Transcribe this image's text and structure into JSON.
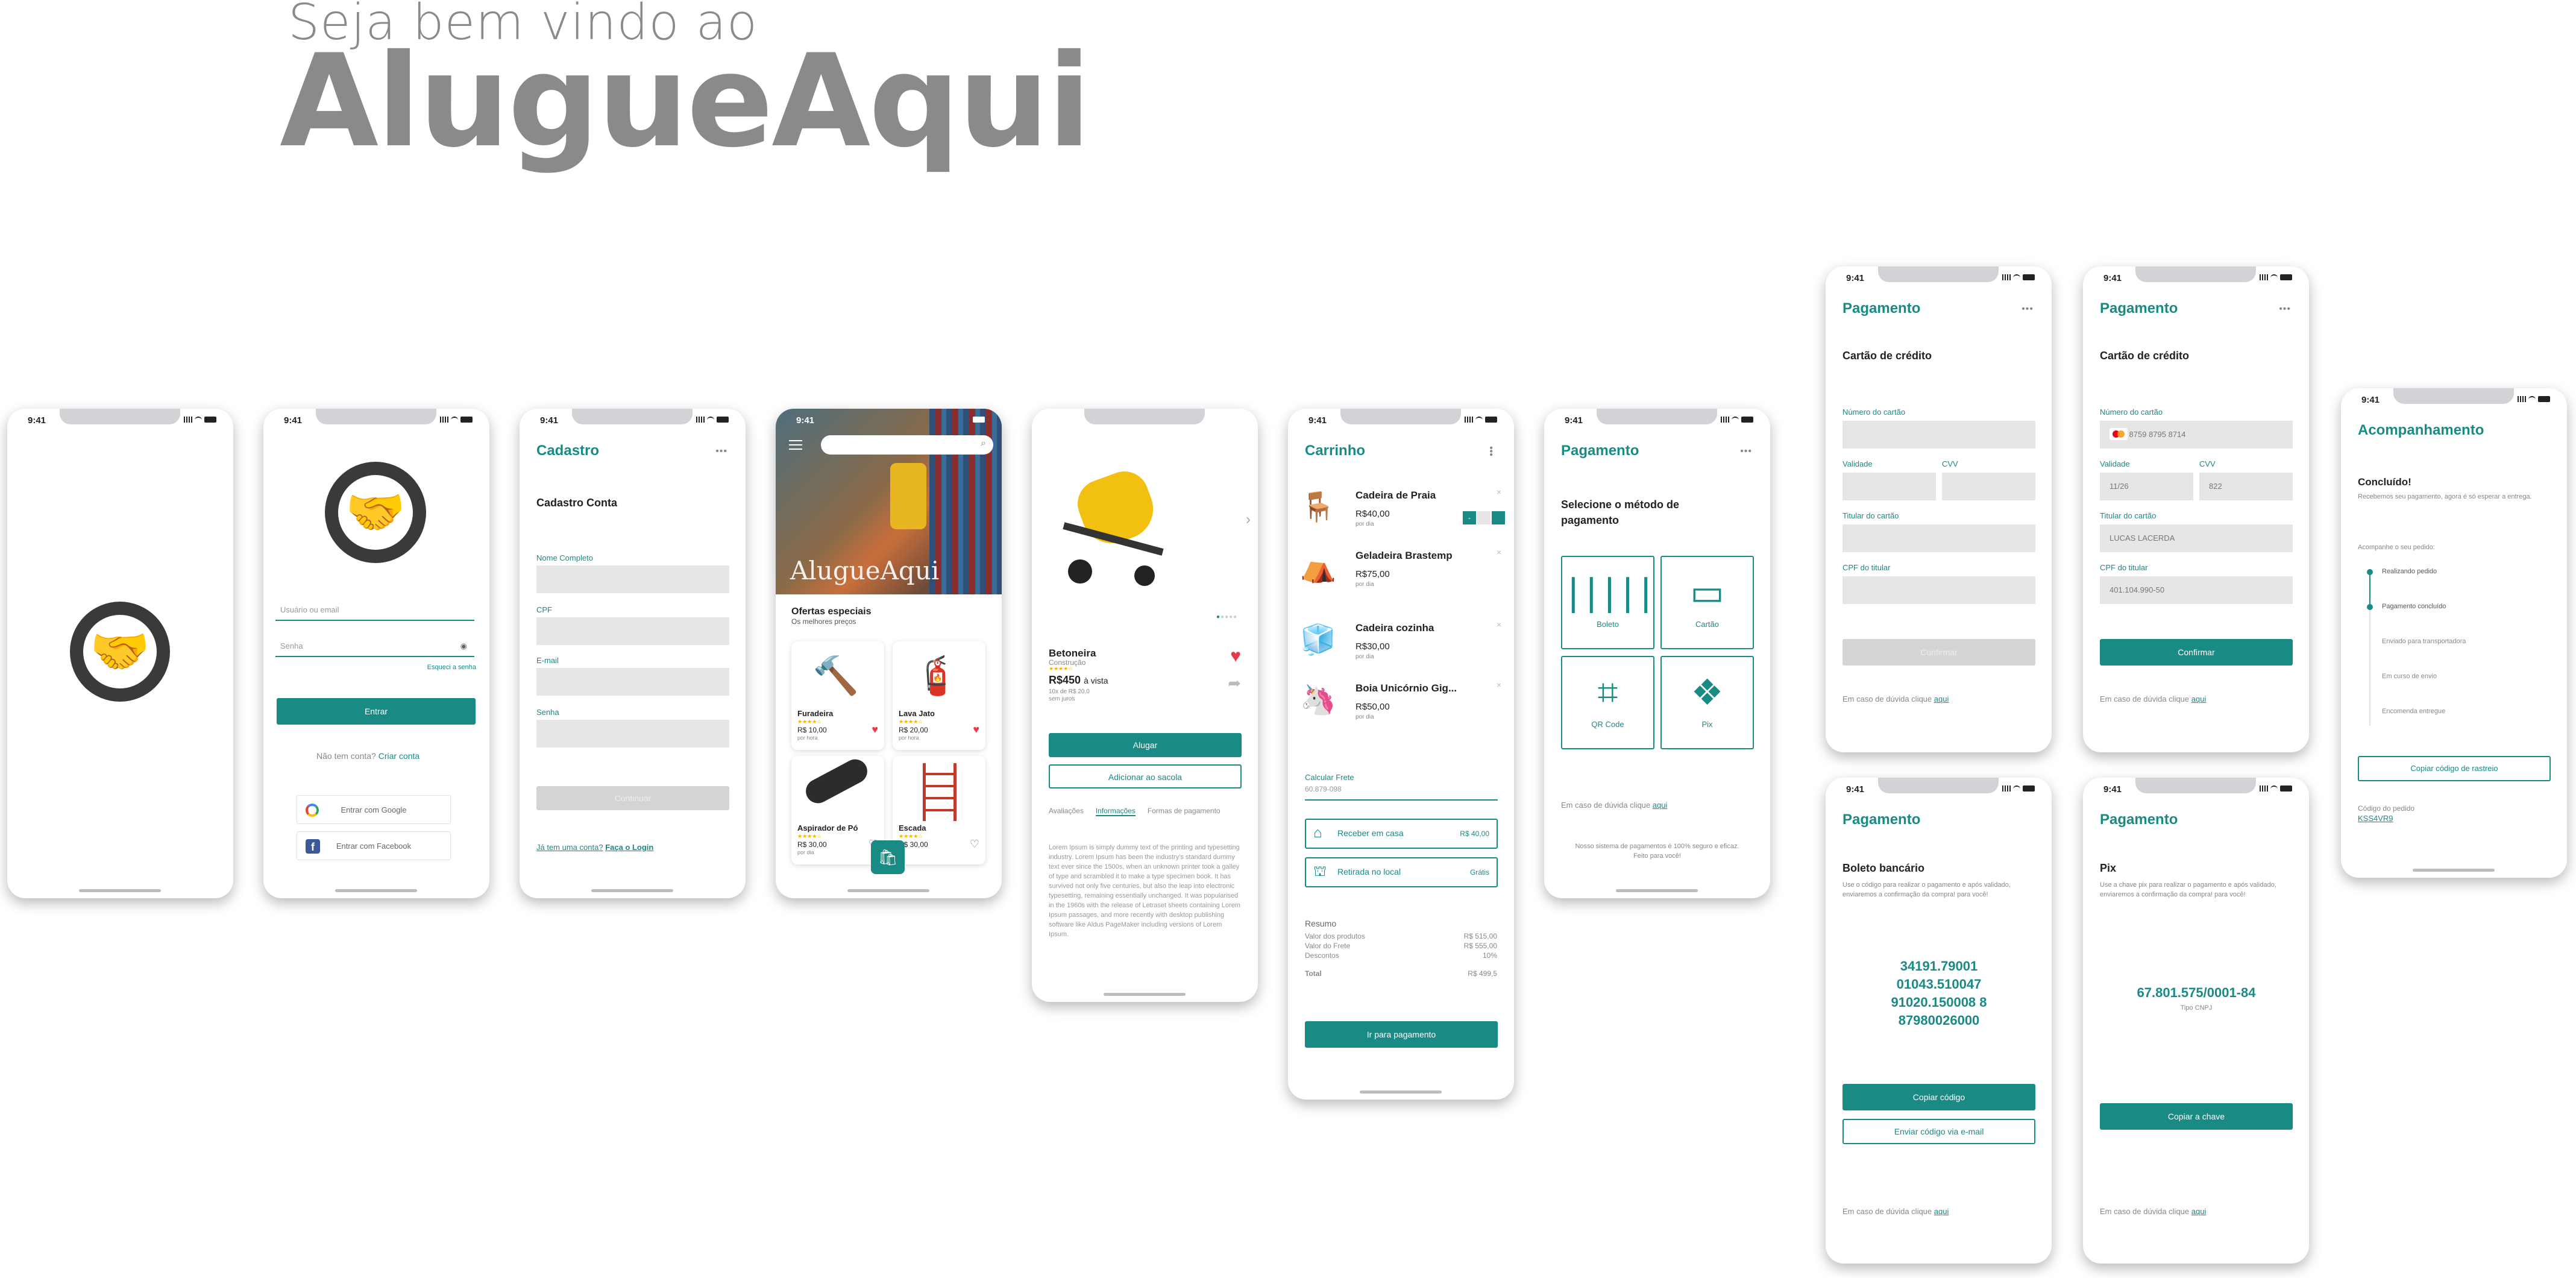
{
  "hero": {
    "subtitle": "Seja bem vindo ao",
    "title": "AlugueAqui"
  },
  "status_time": "9:41",
  "login": {
    "user_placeholder": "Usuário ou email",
    "password_placeholder": "Senha",
    "forgot": "Esqueci a senha",
    "enter": "Entrar",
    "no_account": "Não tem conta?",
    "create": "Criar conta",
    "google": "Entrar com Google",
    "facebook": "Entrar com Facebook"
  },
  "cadastro": {
    "title": "Cadastro",
    "section": "Cadastro Conta",
    "fields": [
      "Nome Completo",
      "CPF",
      "E-mail",
      "Senha"
    ],
    "continue": "Continuar",
    "has_account": "Já tem uma conta?",
    "login": "Faça o Login"
  },
  "home": {
    "brand": "AlugueAqui",
    "offers_title": "Ofertas especiais",
    "offers_sub": "Os melhores preços",
    "products": [
      {
        "name": "Furadeira",
        "price": "R$ 10,00",
        "per": "por hora",
        "fav": true
      },
      {
        "name": "Lava Jato",
        "price": "R$ 20,00",
        "per": "por hora",
        "fav": true
      },
      {
        "name": "Aspirador de Pó",
        "price": "R$ 30,00",
        "per": "por dia",
        "fav": false
      },
      {
        "name": "Escada",
        "price": "R$ 30,00",
        "per": "",
        "fav": false
      }
    ]
  },
  "product": {
    "name": "Betoneira",
    "category": "Construção",
    "price": "R$450",
    "price_suffix": "à vista",
    "installments": "10x de R$ 20,0",
    "interest": "sem juros",
    "rent": "Alugar",
    "add_bag": "Adicionar ao sacola",
    "tabs": [
      "Avaliações",
      "Informações",
      "Formas de pagamento"
    ],
    "description": "Lorem Ipsum is simply dummy text of the printing and typesetting industry. Lorem Ipsum has been the industry's standard dummy text ever since the 1500s, when an unknown printer took a galley of type and scrambled it to make a type specimen book. It has survived not only five centuries, but also the leap into electronic typesetting, remaining essentially unchanged. It was popularised in the 1960s with the release of Letraset sheets containing Lorem Ipsum passages, and more recently with desktop publishing software like Aldus PageMaker including versions of Lorem Ipsum."
  },
  "cart": {
    "title": "Carrinho",
    "items": [
      {
        "name": "Cadeira de Praia",
        "price": "R$40,00",
        "per": "por dia"
      },
      {
        "name": "Geladeira Brastemp",
        "price": "R$75,00",
        "per": "por dia"
      },
      {
        "name": "Cadeira cozinha",
        "price": "R$30,00",
        "per": "por dia"
      },
      {
        "name": "Boia Unicórnio Gig...",
        "price": "R$50,00",
        "per": "por dia"
      }
    ],
    "freight_label": "Calcular Frete",
    "freight_value": "60.879-098",
    "ship_home": "Receber em casa",
    "ship_home_price": "R$ 40,00",
    "ship_pickup": "Retirada no local",
    "ship_pickup_price": "Grátis",
    "summary_title": "Resumo",
    "summary": [
      {
        "label": "Valor dos produtos",
        "value": "R$ 515,00"
      },
      {
        "label": "Valor do Frete",
        "value": "R$ 555,00"
      },
      {
        "label": "Descontos",
        "value": "10%"
      }
    ],
    "total_label": "Total",
    "total_value": "R$ 499,5",
    "checkout": "Ir para pagamento"
  },
  "payment": {
    "title": "Pagamento",
    "select": "Selecione o método de pagamento",
    "methods": [
      "Boleto",
      "Cartão",
      "QR Code",
      "Pix"
    ],
    "help": "Em caso de dúvida clique",
    "help_link": "aqui",
    "secure": "Nosso sistema de pagamentos é 100% seguro e eficaz. Feito para você!"
  },
  "card_empty": {
    "section": "Cartão de crédito",
    "number": "Número do cartão",
    "validity": "Validade",
    "cvv": "CVV",
    "holder": "Titular do cartão",
    "cpf": "CPF do titular",
    "confirm": "Confirmar"
  },
  "card_filled": {
    "number_value": "5596 8759 8795 8714",
    "validity_value": "11/26",
    "cvv_value": "822",
    "holder_value": "LUCAS LACERDA",
    "cpf_value": "401.104.990-50",
    "validity": "Validade"
  },
  "boleto": {
    "section": "Boleto bancário",
    "desc": "Use o código para realizar o pagamento e após validado, enviaremos a confirmação da compra! para você!",
    "code": [
      "34191.79001",
      "01043.510047",
      "91020.150008 8",
      "87980026000"
    ],
    "copy": "Copiar código",
    "email": "Enviar código via e-mail"
  },
  "pix": {
    "section": "Pix",
    "desc": "Use a chave pix para realizar o pagamento e após validado, enviaremos a confirmação da compra! para você!",
    "key": "67.801.575/0001-84",
    "key_type": "Tipo CNPJ",
    "copy": "Copiar a chave"
  },
  "tracking": {
    "title": "Acompanhamento",
    "done": "Concluído!",
    "desc": "Recebemos seu pagamento, agora é só esperar a entrega.",
    "follow": "Acompanhe o seu pedido:",
    "steps": [
      "Realizando pedido",
      "Pagamento concluído",
      "Enviado para transportadora",
      "Em curso de envio",
      "Encomenda entregue"
    ],
    "copy": "Copiar código de rastreio",
    "order_label": "Código do pedido",
    "order_code": "KSS4VR9"
  },
  "colors": {
    "accent": "#1a8a84",
    "heart": "#e53949"
  }
}
